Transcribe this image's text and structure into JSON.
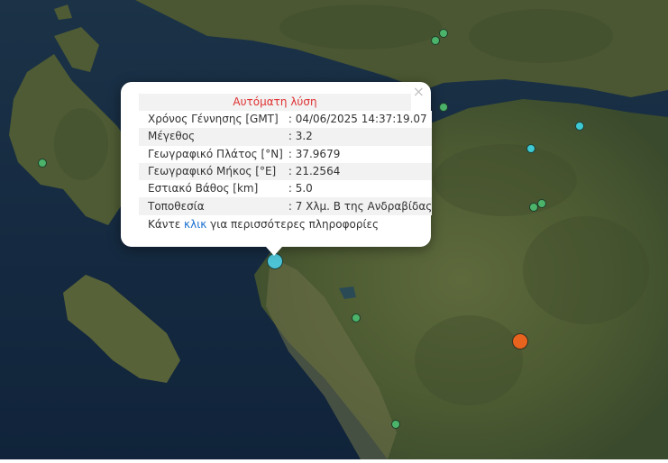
{
  "popup": {
    "title": "Αυτόματη λύση",
    "close_symbol": "×",
    "rows": [
      {
        "label": "Χρόνος Γέννησης [GMT]",
        "value": ": 04/06/2025 14:37:19.07"
      },
      {
        "label": "Μέγεθος",
        "value": ": 3.2"
      },
      {
        "label": "Γεωγραφικό Πλάτος [°N]",
        "value": ": 37.9679"
      },
      {
        "label": "Γεωγραφικό Μήκος [°E]",
        "value": ": 21.2564"
      },
      {
        "label": "Εστιακό Βάθος [km]",
        "value": ": 5.0"
      },
      {
        "label": "Τοποθεσία",
        "value": ": 7 Χλμ. Β της Ανδραβίδας"
      }
    ],
    "footer_prefix": "Κάντε",
    "footer_link": "κλικ",
    "footer_suffix": "για περισσότερες πληροφορίες"
  },
  "colors": {
    "sea": "#14283d",
    "land": "#4a5a33",
    "selected_marker": "#4cc4d6",
    "marker_green": "#4cb36a",
    "marker_cyan": "#3ec9d3",
    "marker_orange": "#e8641e",
    "title_red": "#e03030",
    "link_blue": "#1a6fd0"
  }
}
